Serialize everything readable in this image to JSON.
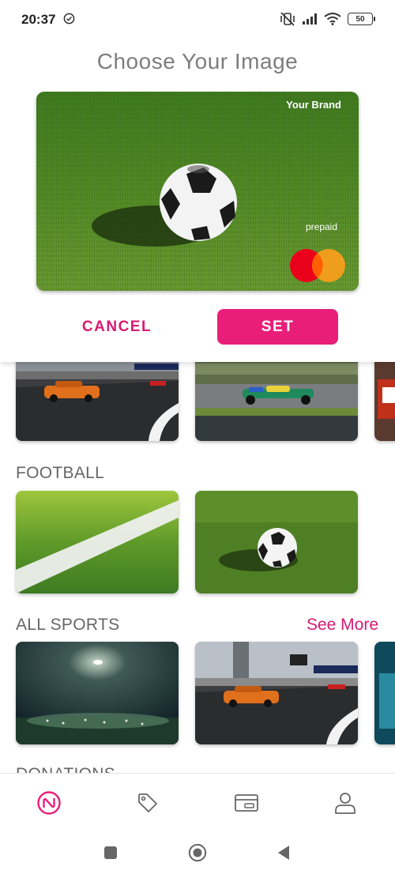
{
  "status_bar": {
    "time": "20:37",
    "battery": "50"
  },
  "modal": {
    "title": "Choose Your Image",
    "card": {
      "brand": "Your Brand",
      "prepaid": "prepaid"
    },
    "cancel_label": "CANCEL",
    "set_label": "SET"
  },
  "sections": {
    "football": {
      "title": "FOOTBALL"
    },
    "all_sports": {
      "title": "ALL SPORTS",
      "see_more": "See More"
    },
    "donations": {
      "title": "DONATIONS"
    }
  },
  "bottom_nav": {
    "items": [
      {
        "icon": "brand-logo-icon",
        "active": true
      },
      {
        "icon": "tag-icon",
        "active": false
      },
      {
        "icon": "card-icon",
        "active": false
      },
      {
        "icon": "user-icon",
        "active": false
      }
    ]
  },
  "colors": {
    "accent": "#e91e79",
    "accent_text": "#d81b72",
    "inactive_icon": "#666666"
  }
}
